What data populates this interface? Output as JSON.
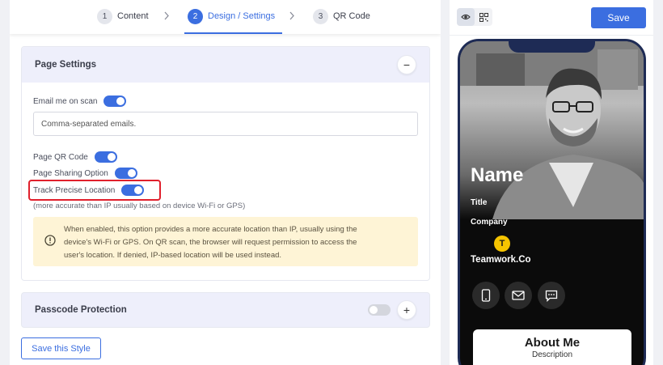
{
  "stepper": {
    "steps": [
      {
        "num": "1",
        "label": "Content"
      },
      {
        "num": "2",
        "label": "Design / Settings"
      },
      {
        "num": "3",
        "label": "QR Code"
      }
    ]
  },
  "page_settings": {
    "title": "Page Settings",
    "collapse_symbol": "−",
    "email_on_scan_label": "Email me on scan",
    "email_on_scan": true,
    "emails_placeholder": "Comma-separated emails.",
    "qr_code_label": "Page QR Code",
    "qr_code": true,
    "sharing_label": "Page Sharing Option",
    "sharing": true,
    "track_location_label": "Track Precise Location",
    "track_location": true,
    "track_hint": "(more accurate than IP usually based on device Wi-Fi or GPS)",
    "note_lines": [
      "When enabled, this option provides a more accurate location than IP, usually using the",
      "device's Wi-Fi or GPS. On QR scan, the browser will request permission to access the",
      "user's location. If denied, IP-based location will be used instead."
    ]
  },
  "passcode": {
    "title": "Passcode Protection",
    "enabled": false,
    "expand_symbol": "+"
  },
  "save_style_label": "Save this Style",
  "preview": {
    "save_label": "Save",
    "card": {
      "name": "Name",
      "title": "Title",
      "company": "Company",
      "logo_letter": "T",
      "organization": "Teamwork.Co",
      "about_heading": "About Me",
      "about_desc": "Description"
    }
  },
  "colors": {
    "accent": "#3b6ee0",
    "highlight": "#e0202c",
    "note_bg": "#fef4d6",
    "logo": "#f5c400"
  },
  "icons": [
    "chevron-right-icon",
    "eye-icon",
    "qr-icon",
    "warning-icon",
    "phone-icon",
    "mail-icon",
    "message-icon"
  ]
}
